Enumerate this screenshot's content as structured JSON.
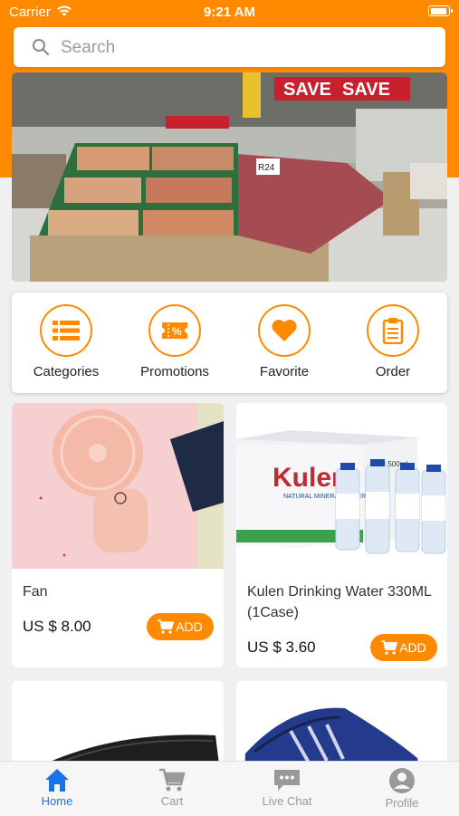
{
  "status_bar": {
    "carrier": "Carrier",
    "time": "9:21 AM"
  },
  "search": {
    "placeholder": "Search"
  },
  "menu": [
    {
      "label": "Categories",
      "icon": "list-icon"
    },
    {
      "label": "Promotions",
      "icon": "ticket-percent-icon"
    },
    {
      "label": "Favorite",
      "icon": "heart-icon"
    },
    {
      "label": "Order",
      "icon": "clipboard-icon"
    }
  ],
  "products": [
    {
      "name": "Fan",
      "price": "US $ 8.00",
      "add_label": "ADD"
    },
    {
      "name": "Kulen Drinking Water 330ML (1Case)",
      "price": "US $ 3.60",
      "add_label": "ADD"
    },
    {
      "name": "",
      "price": "",
      "add_label": ""
    },
    {
      "name": "",
      "price": "",
      "add_label": ""
    }
  ],
  "product_image_text": {
    "box_brand": "Kulen",
    "box_sub": "NATURAL MINERAL WATER",
    "box_count": "24 x 500ml"
  },
  "banner_text": {
    "sign1": "SAVE",
    "sign2": "SAVE",
    "price_tag": "R24"
  },
  "tabbar": [
    {
      "label": "Home",
      "active": true
    },
    {
      "label": "Cart",
      "active": false
    },
    {
      "label": "Live Chat",
      "active": false
    },
    {
      "label": "Profile",
      "active": false
    }
  ],
  "colors": {
    "accent": "#ff8a00",
    "tab_active": "#1a73e8",
    "tab_inactive": "#999999"
  }
}
